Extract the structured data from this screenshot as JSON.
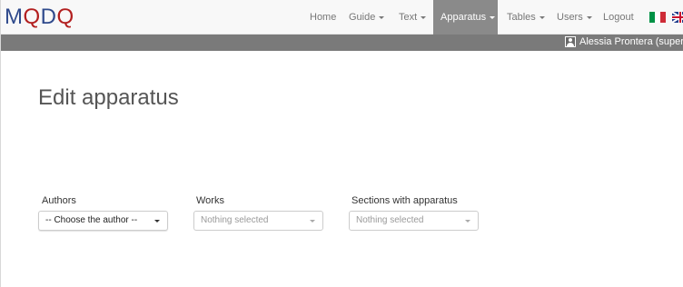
{
  "brand": {
    "letters": [
      "M",
      "Q",
      "D",
      "Q"
    ]
  },
  "nav": {
    "items": [
      {
        "label": "Home",
        "dropdown": false
      },
      {
        "label": "Guide",
        "dropdown": true
      },
      {
        "label": "Text",
        "dropdown": true
      },
      {
        "label": "Apparatus",
        "dropdown": true,
        "active": true
      },
      {
        "label": "Tables",
        "dropdown": true
      },
      {
        "label": "Users",
        "dropdown": true
      },
      {
        "label": "Logout",
        "dropdown": false
      }
    ],
    "languages": [
      "it-flag",
      "uk-flag"
    ]
  },
  "user": {
    "name": "Alessia Prontera (supervisor)",
    "icon": "user-icon"
  },
  "page": {
    "title": "Edit apparatus"
  },
  "filters": {
    "authors": {
      "label": "Authors",
      "value": "-- Choose the author --"
    },
    "works": {
      "label": "Works",
      "placeholder": "Nothing selected"
    },
    "sections": {
      "label": "Sections with apparatus",
      "placeholder": "Nothing selected"
    }
  },
  "colors": {
    "brand_blue": "#2f4a8c",
    "brand_red": "#b21f1f",
    "active_nav": "#8a8a8a",
    "user_bar": "#7a7a7a"
  }
}
